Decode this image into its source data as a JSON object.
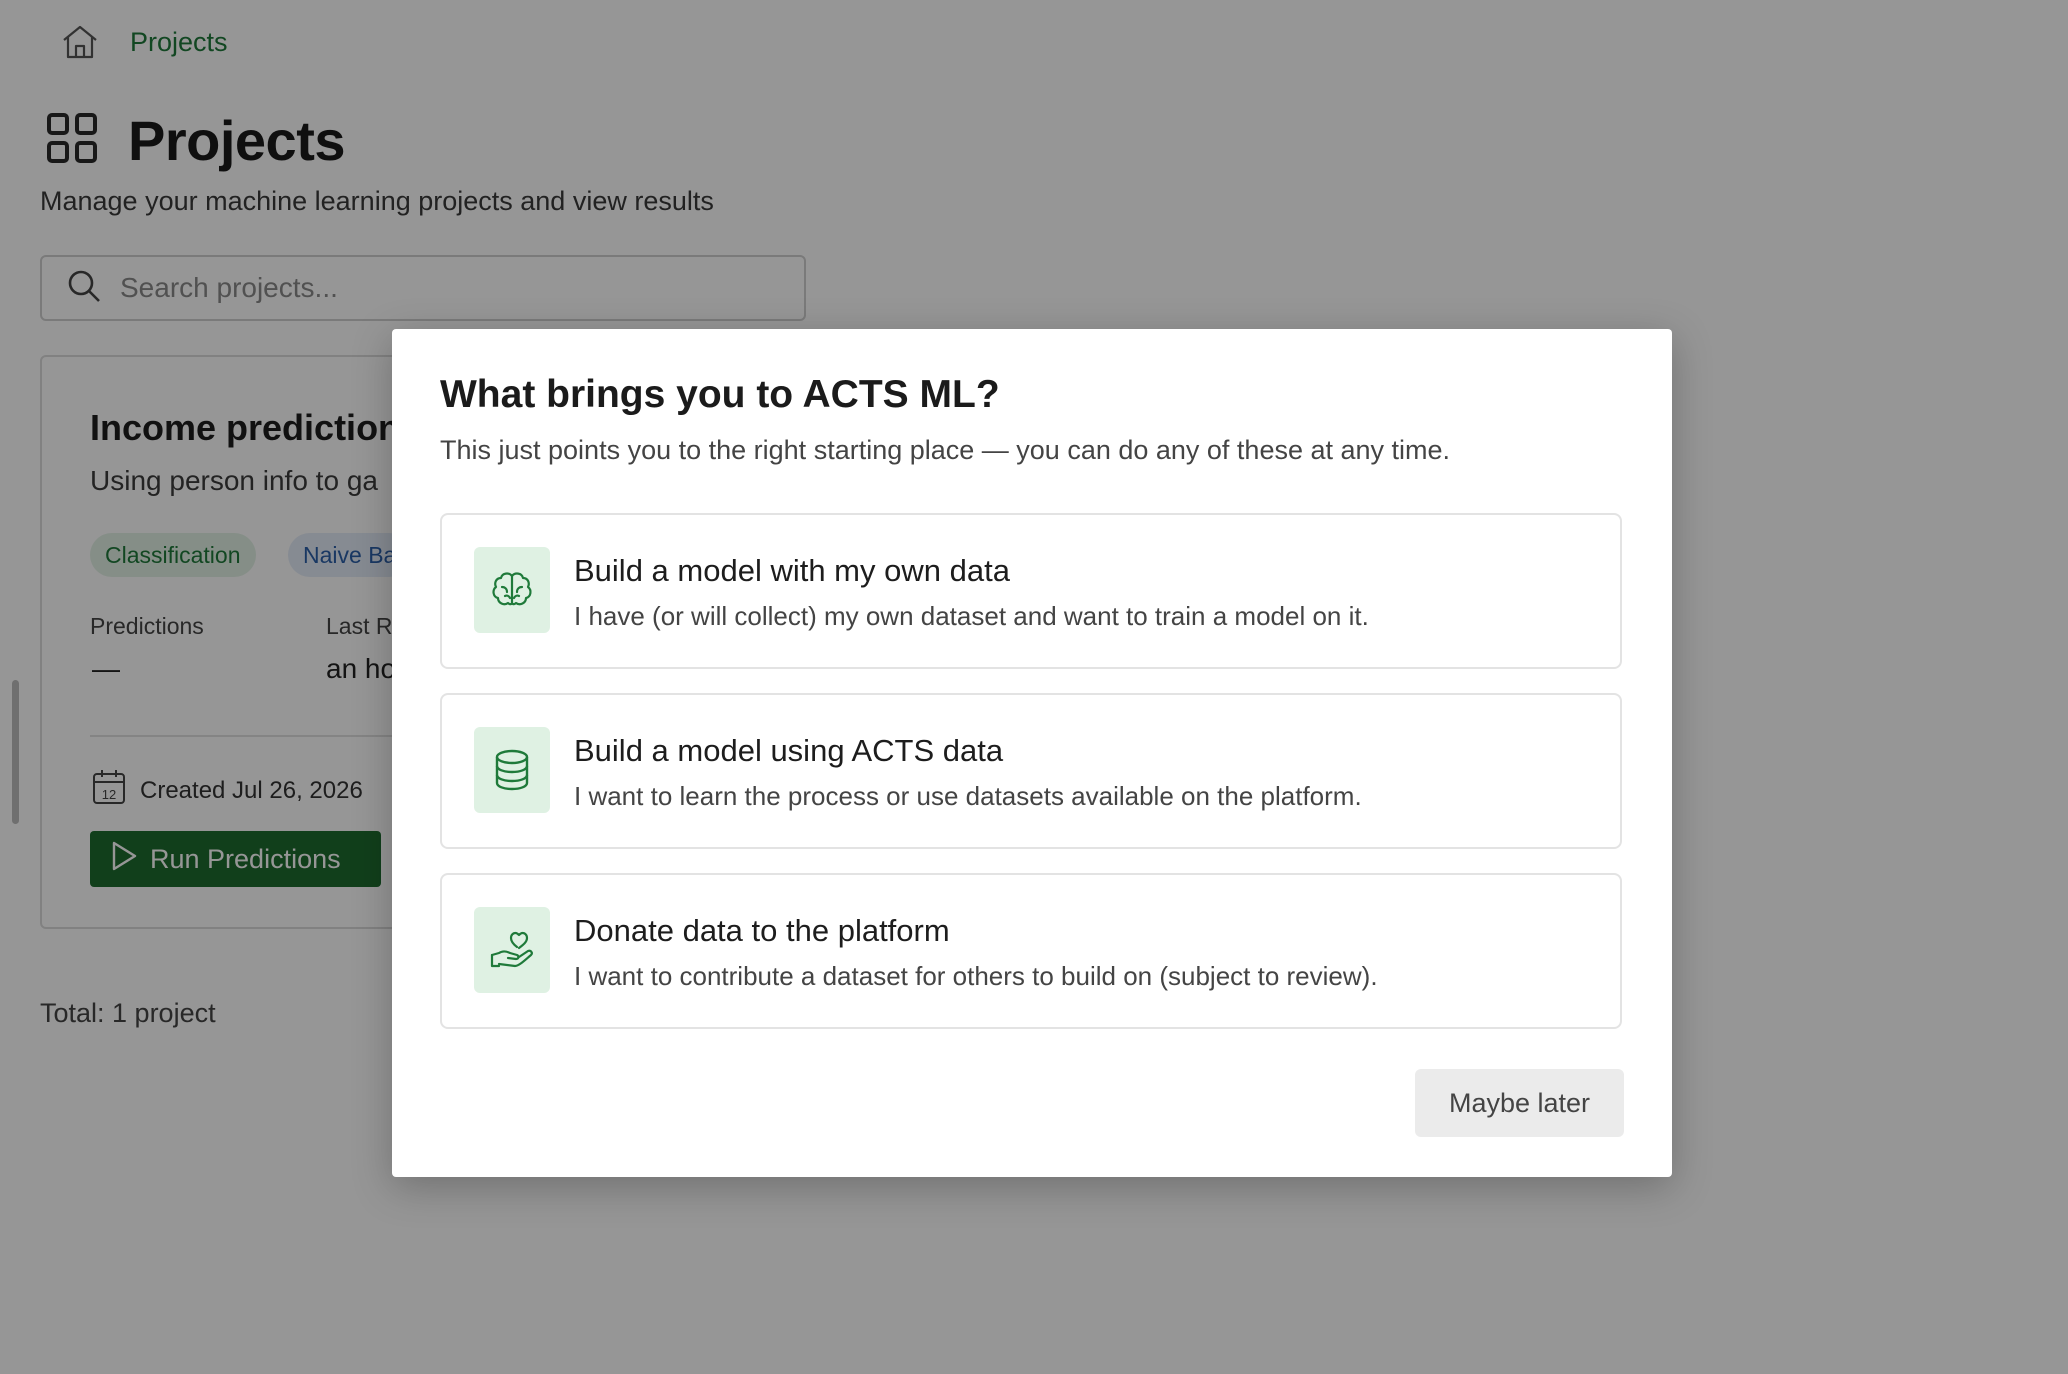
{
  "breadcrumb": {
    "home_icon": "home-icon",
    "current": "Projects"
  },
  "header": {
    "icon": "grid-icon",
    "title": "Projects",
    "subtitle": "Manage your machine learning projects and view results"
  },
  "search": {
    "placeholder": "Search projects..."
  },
  "project_card": {
    "name": "Income prediction",
    "description": "Using person info to ga",
    "tags": [
      "Classification",
      "Naive Ba"
    ],
    "stats": [
      {
        "label": "Predictions",
        "value": "—"
      },
      {
        "label": "Last R",
        "value": "an ho"
      }
    ],
    "created": "Created Jul 26, 2026",
    "calendar_day": "12",
    "run_button": "Run Predictions"
  },
  "footer": {
    "total": "Total: 1 project"
  },
  "modal": {
    "title": "What brings you to ACTS ML?",
    "lead": "This just points you to the right starting place — you can do any of these at any time.",
    "options": [
      {
        "icon": "brain-icon",
        "title": "Build a model with my own data",
        "description": "I have (or will collect) my own dataset and want to train a model on it."
      },
      {
        "icon": "database-icon",
        "title": "Build a model using ACTS data",
        "description": "I want to learn the process or use datasets available on the platform."
      },
      {
        "icon": "hand-heart-icon",
        "title": "Donate data to the platform",
        "description": "I want to contribute a dataset for others to build on (subject to review)."
      }
    ],
    "dismiss": "Maybe later"
  },
  "colors": {
    "accent": "#1e6b2f",
    "icon_bg": "#dff1e3",
    "overlay": "rgba(0,0,0,0.41)"
  }
}
